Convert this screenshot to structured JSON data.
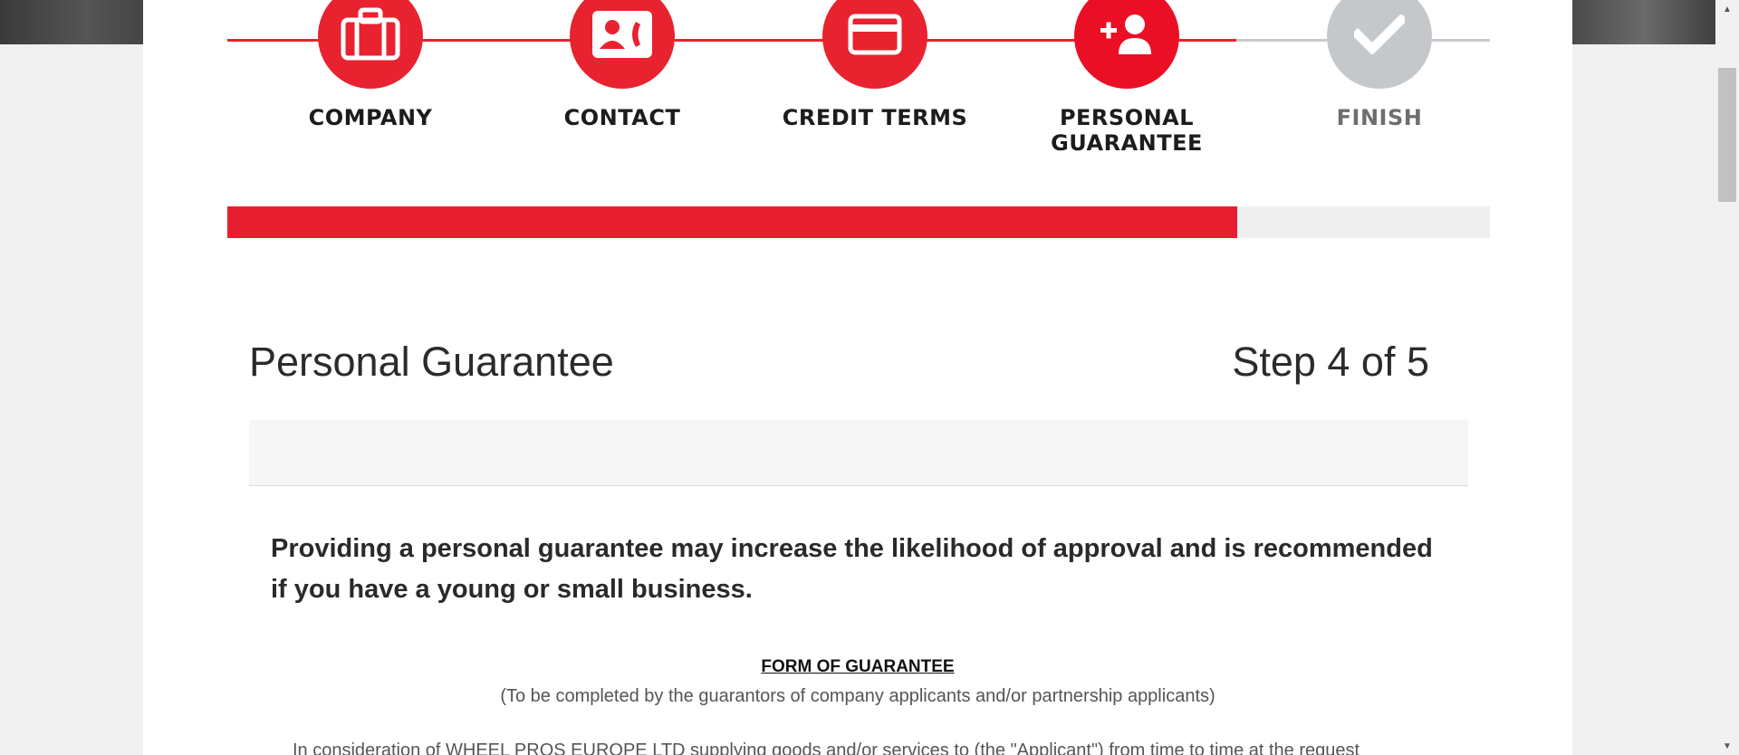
{
  "stepper": {
    "steps": [
      {
        "label": "COMPANY",
        "icon": "briefcase-icon",
        "state": "done"
      },
      {
        "label": "CONTACT",
        "icon": "contact-card-icon",
        "state": "done"
      },
      {
        "label": "CREDIT TERMS",
        "icon": "credit-card-icon",
        "state": "done"
      },
      {
        "label": "PERSONAL GUARANTEE",
        "icon": "add-person-icon",
        "state": "active"
      },
      {
        "label": "FINISH",
        "icon": "checkmark-icon",
        "state": "todo"
      }
    ],
    "progress_fraction": 0.8
  },
  "section": {
    "title": "Personal Guarantee",
    "step_counter": "Step 4 of 5"
  },
  "content": {
    "lead": "Providing a personal guarantee may increase the likelihood of approval and is recommended if you have a young or small business.",
    "form_title": "FORM OF GUARANTEE",
    "form_subtitle": "(To be completed by the guarantors of company applicants and/or partnership applicants)",
    "body": "In consideration of WHEEL PROS EUROPE LTD supplying goods and/or services to (the \"Applicant\") from time to time at the request"
  },
  "colors": {
    "accent": "#e8222f",
    "pending": "#c5c8cb",
    "progress_track": "#eeeeee"
  }
}
